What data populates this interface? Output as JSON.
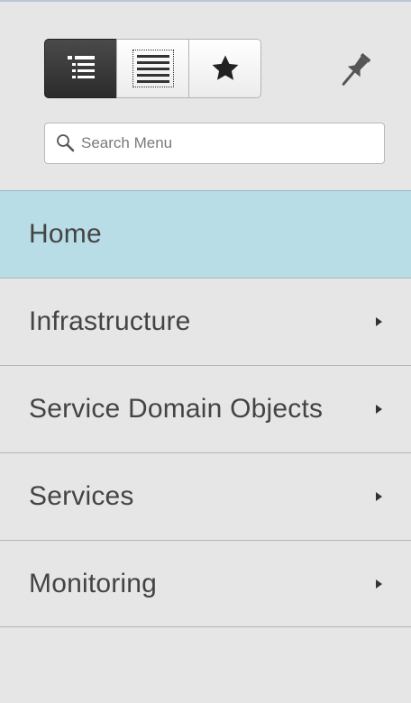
{
  "toolbar": {
    "buttons": [
      {
        "icon": "indented-list-icon",
        "active": true
      },
      {
        "icon": "list-icon",
        "active": false
      },
      {
        "icon": "star-icon",
        "active": false
      }
    ],
    "pin_icon": "pin-icon"
  },
  "search": {
    "placeholder": "Search Menu",
    "value": ""
  },
  "menu": {
    "items": [
      {
        "label": "Home",
        "selected": true,
        "has_submenu": false
      },
      {
        "label": "Infrastructure",
        "selected": false,
        "has_submenu": true
      },
      {
        "label": "Service Domain Objects",
        "selected": false,
        "has_submenu": true
      },
      {
        "label": "Services",
        "selected": false,
        "has_submenu": true
      },
      {
        "label": "Monitoring",
        "selected": false,
        "has_submenu": true
      }
    ]
  },
  "colors": {
    "selected_bg": "#b9dde6",
    "panel_bg": "#e6e6e6",
    "active_button": "#333333"
  }
}
